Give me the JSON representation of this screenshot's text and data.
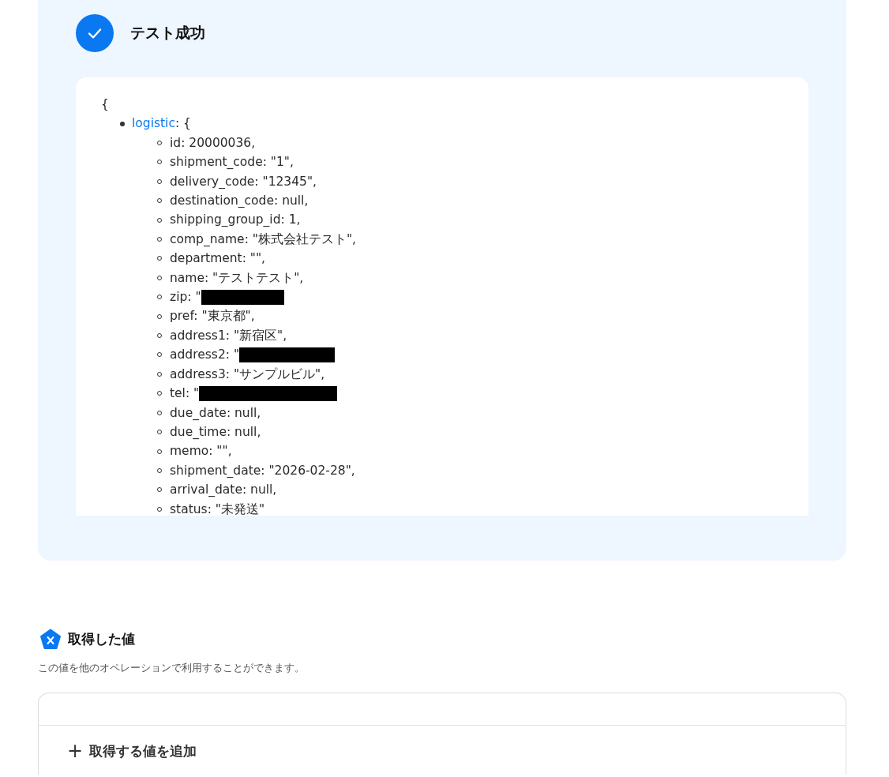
{
  "result": {
    "success": true,
    "title": "テスト成功",
    "json_view": {
      "open_brace": "{",
      "key": "logistic",
      "key_suffix": ": {",
      "fields": [
        {
          "text": "id: 20000036,",
          "redacted": false
        },
        {
          "text": "shipment_code: \"1\",",
          "redacted": false
        },
        {
          "text": "delivery_code: \"12345\",",
          "redacted": false
        },
        {
          "text": "destination_code: null,",
          "redacted": false
        },
        {
          "text": "shipping_group_id: 1,",
          "redacted": false
        },
        {
          "text": "comp_name: \"株式会社テスト\",",
          "redacted": false
        },
        {
          "text": "department: \"\",",
          "redacted": false
        },
        {
          "text": "name: \"テストテスト\",",
          "redacted": false
        },
        {
          "text": "zip: \"",
          "redacted": true
        },
        {
          "text": "pref: \"東京都\",",
          "redacted": false
        },
        {
          "text": "address1: \"新宿区\",",
          "redacted": false
        },
        {
          "text": "address2: \"",
          "redacted": true
        },
        {
          "text": "address3: \"サンプルビル\",",
          "redacted": false
        },
        {
          "text": "tel: \"",
          "redacted": true
        },
        {
          "text": "due_date: null,",
          "redacted": false
        },
        {
          "text": "due_time: null,",
          "redacted": false
        },
        {
          "text": "memo: \"\",",
          "redacted": false
        },
        {
          "text": "shipment_date: \"2026-02-28\",",
          "redacted": false
        },
        {
          "text": "arrival_date: null,",
          "redacted": false
        },
        {
          "text": "status: \"未発送\"",
          "redacted": false
        }
      ]
    }
  },
  "acquired_values": {
    "title": "取得した値",
    "description": "この値を他のオペレーションで利用することができます。",
    "add_button": {
      "icon": "+",
      "label": "取得する値を追加"
    }
  }
}
